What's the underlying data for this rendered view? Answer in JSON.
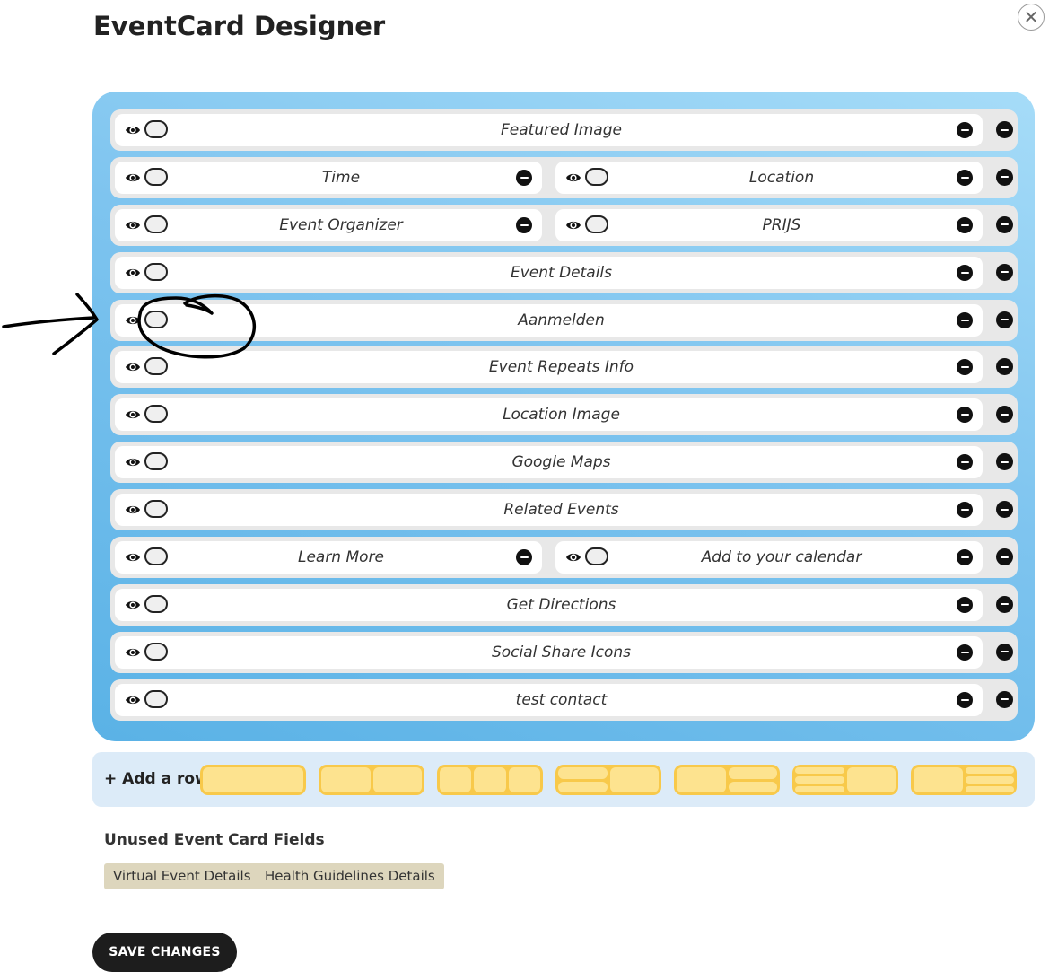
{
  "header": {
    "title": "EventCard Designer"
  },
  "close": {
    "icon": "close-icon"
  },
  "rows": [
    {
      "cells": [
        "Featured Image"
      ]
    },
    {
      "cells": [
        "Time",
        "Location"
      ]
    },
    {
      "cells": [
        "Event Organizer",
        "PRIJS"
      ]
    },
    {
      "cells": [
        "Event Details"
      ]
    },
    {
      "cells": [
        "Aanmelden"
      ]
    },
    {
      "cells": [
        "Event Repeats Info"
      ]
    },
    {
      "cells": [
        "Location Image"
      ]
    },
    {
      "cells": [
        "Google Maps"
      ]
    },
    {
      "cells": [
        "Related Events"
      ]
    },
    {
      "cells": [
        "Learn More",
        "Add to your calendar"
      ]
    },
    {
      "cells": [
        "Get Directions"
      ]
    },
    {
      "cells": [
        "Social Share Icons"
      ]
    },
    {
      "cells": [
        "test contact"
      ]
    }
  ],
  "add_row": {
    "label": "+ Add a row",
    "layouts": [
      "single",
      "two-columns",
      "three-columns",
      "stacked-left-single-right",
      "single-left-stacked-right",
      "triple-stacked-left-single-right",
      "single-left-triple-stacked-right"
    ]
  },
  "unused": {
    "title": "Unused Event Card Fields",
    "fields": [
      "Virtual Event Details",
      "Health Guidelines Details"
    ]
  },
  "save": {
    "label": "SAVE CHANGES"
  },
  "colors": {
    "accent": "#5ab2e6",
    "row_bg": "#e8e8e8",
    "layout_button": "#f8c94a",
    "chip_bg": "#ddd6bd",
    "save_bg": "#1d1d1d"
  }
}
